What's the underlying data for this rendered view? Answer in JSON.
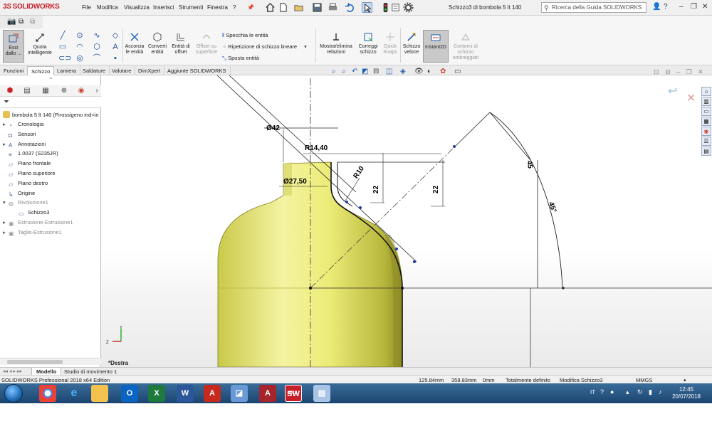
{
  "app": {
    "brand": "SOLIDWORKS",
    "brand_prefix": "3S",
    "document_title": "Schizzo3 di bombola 5 lt 140"
  },
  "menu": [
    "File",
    "Modifica",
    "Visualizza",
    "Inserisci",
    "Strumenti",
    "Finestra",
    "?"
  ],
  "search": {
    "placeholder": "Ricerca della Guida SOLIDWORKS"
  },
  "commands": {
    "exit_sketch": "Esci dallo ...",
    "smart_dim": "Quota intelligente",
    "trim": "Accorcia le entità",
    "convert": "Converti entità",
    "offset": "Entità di offset",
    "offset_surface": "Offset su superficie",
    "mirror": "Specchia le entità",
    "linear_pattern": "Ripetizione di schizzo lineare",
    "move": "Sposta entità",
    "relations": "Mostra/elimina relazioni",
    "repair": "Correggi schizzo",
    "quick_snaps": "Quick Snaps",
    "rapid_sketch": "Schizzo veloce",
    "instant2d": "Instant2D",
    "shaded_contours": "Contorni di schizzo ombreggiati"
  },
  "tabs": [
    "Funzioni",
    "Schizzo",
    "Lamiera",
    "Saldature",
    "Valutare",
    "DimXpert",
    "Aggiunte SOLIDWORKS"
  ],
  "active_tab": "Schizzo",
  "tree": {
    "root": "bombola 5 lt 140  (Pirossigeno ind<in",
    "items": [
      {
        "label": "Cronologia",
        "expand": "▸",
        "dim": false
      },
      {
        "label": "Sensori",
        "expand": "",
        "dim": false
      },
      {
        "label": "Annotazioni",
        "expand": "▸",
        "dim": false
      },
      {
        "label": "1.0037 (S235JR)",
        "expand": "",
        "dim": false
      },
      {
        "label": "Piano frontale",
        "expand": "",
        "dim": false
      },
      {
        "label": "Piano superiore",
        "expand": "",
        "dim": false
      },
      {
        "label": "Piano destro",
        "expand": "",
        "dim": false
      },
      {
        "label": "Origine",
        "expand": "",
        "dim": false
      },
      {
        "label": "Rivoluzione1",
        "expand": "▾",
        "dim": true
      },
      {
        "label": "Schizzo3",
        "expand": "",
        "dim": false
      },
      {
        "label": "Estrusione-Estrusione1",
        "expand": "▸",
        "dim": true
      },
      {
        "label": "Taglio-Estrusione1",
        "expand": "▸",
        "dim": true
      }
    ]
  },
  "dimensions": {
    "d42": "Ø42",
    "r1440": "R14,40",
    "d2750": "Ø27,50",
    "r10": "R10",
    "v22a": "22",
    "v22b": "22",
    "v45a": "45",
    "v45b": "45°"
  },
  "view_label": "*Destra",
  "model_tabs": [
    "Modello",
    "Studio di movimento 1"
  ],
  "status": {
    "edition": "SOLIDWORKS Professional 2018 x64 Edition",
    "x": "125.84mm",
    "y": "358.83mm",
    "z": "0mm",
    "state": "Totalmente definito",
    "editing": "Modifica Schizzo3",
    "units": "MMGS"
  },
  "taskbar": {
    "apps": [
      "chrome",
      "internet-explorer",
      "file-explorer",
      "outlook",
      "excel",
      "word",
      "acrobat",
      "onenote",
      "access",
      "solidworks",
      "notepad"
    ],
    "sw_label": "2018"
  },
  "tray": {
    "lang": "IT",
    "time": "12:45",
    "date": "20/07/2018"
  },
  "colors": {
    "brand": "#c8202a",
    "body": "#e8e870",
    "sketch": "#1a1a1a",
    "dim": "#000000",
    "point": "#1d3aa8",
    "taskbar": "#1f4e7a"
  }
}
